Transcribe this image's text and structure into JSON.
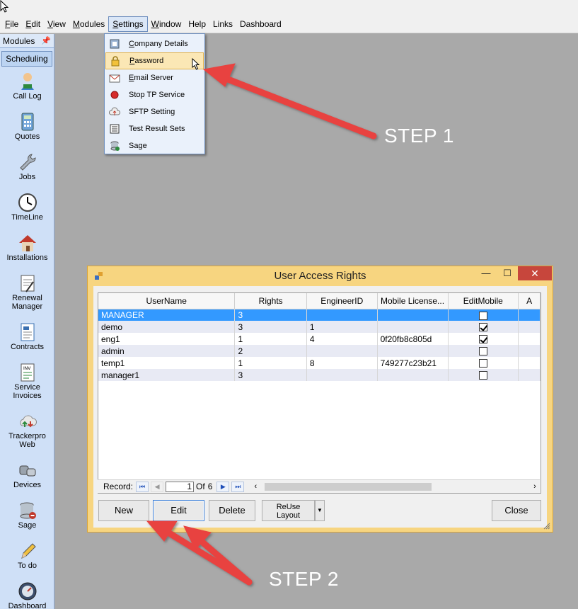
{
  "menubar": {
    "items": [
      {
        "label": "File",
        "u": "F",
        "rest": "ile"
      },
      {
        "label": "Edit",
        "u": "E",
        "rest": "dit"
      },
      {
        "label": "View",
        "u": "V",
        "rest": "iew"
      },
      {
        "label": "Modules",
        "u": "M",
        "rest": "odules"
      },
      {
        "label": "Settings",
        "u": "S",
        "rest": "ettings"
      },
      {
        "label": "Window",
        "u": "W",
        "rest": "indow"
      },
      {
        "label": "Help",
        "u": "",
        "rest": "Help"
      },
      {
        "label": "Links",
        "u": "",
        "rest": "Links"
      },
      {
        "label": "Dashboard",
        "u": "",
        "rest": "Dashboard"
      }
    ]
  },
  "sidebar": {
    "header": "Modules",
    "tab": "Scheduling",
    "items": [
      {
        "label": "Call Log",
        "icon": "call-log-icon"
      },
      {
        "label": "Quotes",
        "icon": "calculator-icon"
      },
      {
        "label": "Jobs",
        "icon": "wrench-icon"
      },
      {
        "label": "TimeLine",
        "icon": "clock-icon"
      },
      {
        "label": "Installations",
        "icon": "house-icon"
      },
      {
        "label": "Renewal\nManager",
        "icon": "renewal-icon"
      },
      {
        "label": "Contracts",
        "icon": "document-icon"
      },
      {
        "label": "Service\nInvoices",
        "icon": "invoice-icon"
      },
      {
        "label": "Trackerpro\nWeb",
        "icon": "cloud-icon"
      },
      {
        "label": "Devices",
        "icon": "devices-icon"
      },
      {
        "label": "Sage",
        "icon": "database-icon"
      },
      {
        "label": "To do",
        "icon": "pencil-icon"
      },
      {
        "label": "Dashboard",
        "icon": "gauge-icon"
      }
    ]
  },
  "settings_menu": {
    "items": [
      {
        "label": "Company Details",
        "u": "C",
        "rest": "ompany Details",
        "icon": "company-icon"
      },
      {
        "label": "Password",
        "u": "P",
        "rest": "assword",
        "icon": "lock-icon",
        "highlighted": true
      },
      {
        "label": "Email Server",
        "u": "E",
        "rest": "mail Server",
        "icon": "email-icon"
      },
      {
        "label": "Stop TP Service",
        "u": "",
        "rest": "Stop TP Service",
        "icon": "stop-icon"
      },
      {
        "label": "SFTP Setting",
        "u": "",
        "rest": "SFTP Setting",
        "icon": "sftp-icon"
      },
      {
        "label": "Test Result Sets",
        "u": "",
        "rest": "Test Result Sets",
        "icon": "list-icon"
      },
      {
        "label": "Sage",
        "u": "",
        "rest": "Sage",
        "icon": "sage-icon"
      }
    ]
  },
  "annotations": {
    "step1": "STEP 1",
    "step2": "STEP 2",
    "arrow_color": "#e8423f"
  },
  "dialog": {
    "title": "User Access Rights",
    "controls": {
      "minimize": "—",
      "maximize": "☐",
      "close": "✕"
    },
    "columns": [
      "UserName",
      "Rights",
      "EngineerID",
      "Mobile License...",
      "EditMobile",
      "A"
    ],
    "rows": [
      {
        "username": "MANAGER",
        "rights": "3",
        "engineer_id": "",
        "mobile_license": "",
        "edit_mobile": false,
        "selected": true
      },
      {
        "username": "demo",
        "rights": "3",
        "engineer_id": "1",
        "mobile_license": "",
        "edit_mobile": true
      },
      {
        "username": "eng1",
        "rights": "1",
        "engineer_id": "4",
        "mobile_license": "0f20fb8c805d",
        "edit_mobile": true
      },
      {
        "username": "admin",
        "rights": "2",
        "engineer_id": "",
        "mobile_license": "",
        "edit_mobile": false
      },
      {
        "username": "temp1",
        "rights": "1",
        "engineer_id": "8",
        "mobile_license": "749277c23b21",
        "edit_mobile": false
      },
      {
        "username": "manager1",
        "rights": "3",
        "engineer_id": "",
        "mobile_license": "",
        "edit_mobile": false
      }
    ],
    "navigator": {
      "label": "Record:",
      "current": "1",
      "of": "Of",
      "total": "6"
    },
    "buttons": {
      "new": "New",
      "edit": "Edit",
      "delete": "Delete",
      "reuse_line1": "ReUse",
      "reuse_line2": "Layout",
      "close": "Close"
    }
  },
  "colors": {
    "selection": "#3399ff",
    "dialog_frame": "#f7d580",
    "workspace": "#a9a9a9",
    "menu_highlight": "#fbe7b5"
  }
}
